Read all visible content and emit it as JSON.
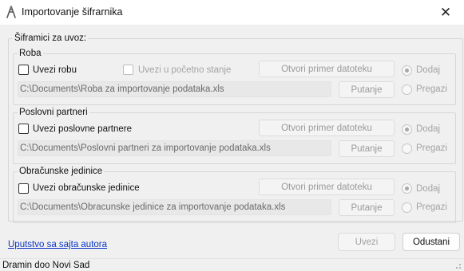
{
  "window": {
    "title": "Importovanje šifrarnika",
    "close_glyph": "✕",
    "icon": "app-icon"
  },
  "outer_group": {
    "legend": "Šiframici za uvoz:"
  },
  "groups": [
    {
      "legend": "Roba",
      "checkbox_label": "Uvezi robu",
      "checked": false,
      "secondary_checkbox_label": "Uvezi u početno stanje",
      "open_button": "Otvori primer datoteku",
      "path": "C:\\Documents\\Roba za importovanje podataka.xls",
      "path_button": "Putanje",
      "radio_add": "Dodaj",
      "radio_overwrite": "Pregazi",
      "selected_mode": "Dodaj"
    },
    {
      "legend": "Poslovni partneri",
      "checkbox_label": "Uvezi poslovne partnere",
      "checked": false,
      "open_button": "Otvori primer datoteku",
      "path": "C:\\Documents\\Poslovni partneri za importovanje podataka.xls",
      "path_button": "Putanje",
      "radio_add": "Dodaj",
      "radio_overwrite": "Pregazi",
      "selected_mode": "Dodaj"
    },
    {
      "legend": "Obračunske jedinice",
      "checkbox_label": "Uvezi obračunske jedinice",
      "checked": false,
      "open_button": "Otvori primer datoteku",
      "path": "C:\\Documents\\Obracunske jedinice za importovanje podataka.xls",
      "path_button": "Putanje",
      "radio_add": "Dodaj",
      "radio_overwrite": "Pregazi",
      "selected_mode": "Dodaj"
    }
  ],
  "footer": {
    "link": "Uputstvo sa sajta autora",
    "import_button": "Uvezi",
    "cancel_button": "Odustani"
  },
  "status_bar": {
    "text": "Dramin doo Novi Sad"
  },
  "colors": {
    "background": "#f0f0f0",
    "link": "#0a34c8",
    "disabled_text": "#a3a3a3"
  }
}
